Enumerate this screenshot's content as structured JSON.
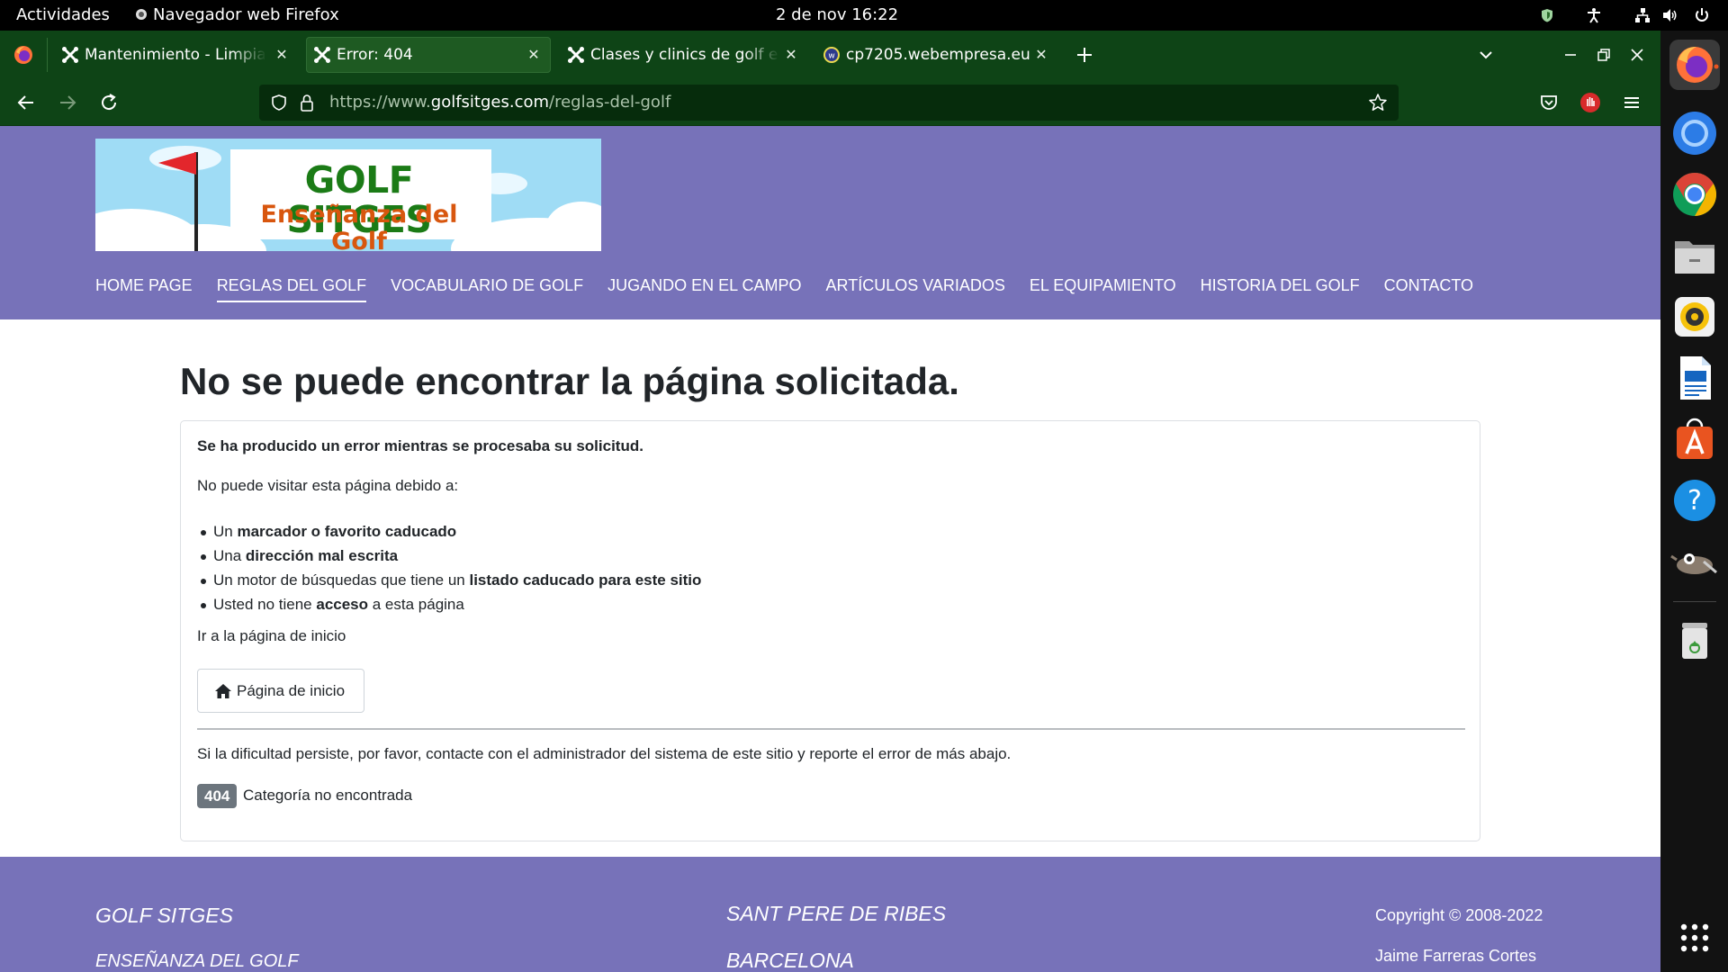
{
  "topbar": {
    "activities": "Actividades",
    "app_name": "Navegador web Firefox",
    "clock": "2 de nov  16:22"
  },
  "tabs": [
    {
      "label": "Mantenimiento - Limpiar",
      "favicon": "joomla-icon",
      "active": false
    },
    {
      "label": "Error: 404",
      "favicon": "joomla-icon",
      "active": true
    },
    {
      "label": "Clases y clinics de golf en",
      "favicon": "joomla-icon",
      "active": false
    },
    {
      "label": "cp7205.webempresa.eu",
      "favicon": "webempresa-icon",
      "active": false
    }
  ],
  "urlbar": {
    "scheme": "https://www.",
    "domain": "golfsitges.com",
    "path": "/reglas-del-golf"
  },
  "logo": {
    "line1": "GOLF SITGES",
    "line2": "Enseñanza del Golf"
  },
  "menu": [
    {
      "label": "HOME PAGE",
      "current": false
    },
    {
      "label": "REGLAS DEL GOLF",
      "current": true
    },
    {
      "label": "VOCABULARIO DE GOLF",
      "current": false
    },
    {
      "label": "JUGANDO EN EL CAMPO",
      "current": false
    },
    {
      "label": "ARTÍCULOS VARIADOS",
      "current": false
    },
    {
      "label": "EL EQUIPAMIENTO",
      "current": false
    },
    {
      "label": "HISTORIA DEL GOLF",
      "current": false
    },
    {
      "label": "CONTACTO",
      "current": false
    }
  ],
  "error": {
    "title": "No se puede encontrar la página solicitada.",
    "intro": "Se ha producido un error mientras se procesaba su solicitud.",
    "reason_lead": "No puede visitar esta página debido a:",
    "reasons": [
      {
        "pre": "Un ",
        "bold": "marcador o favorito caducado",
        "post": ""
      },
      {
        "pre": "Una ",
        "bold": "dirección mal escrita",
        "post": ""
      },
      {
        "pre": "Un motor de búsquedas que tiene un ",
        "bold": "listado caducado para este sitio",
        "post": ""
      },
      {
        "pre": "Usted no tiene ",
        "bold": "acceso",
        "post": " a esta página"
      }
    ],
    "go_home_text": "Ir a la página de inicio",
    "home_button": "Página de inicio",
    "persist_text": "Si la dificultad persiste, por favor, contacte con el administrador del sistema de este sitio y reporte el error de más abajo.",
    "code": "404",
    "message": "Categoría no encontrada"
  },
  "footer": {
    "col1_line1": "GOLF SITGES",
    "col1_line2": "ENSEÑANZA DEL GOLF",
    "col2_line1": "SANT PERE DE RIBES",
    "col2_line2": "BARCELONA",
    "col3_line1": "Copyright © 2008-2022",
    "col3_line2": "Jaime Farreras Cortes"
  },
  "dock_apps": [
    "firefox-icon",
    "chromium-icon",
    "chrome-icon",
    "files-icon",
    "rhythmbox-icon",
    "writer-icon",
    "app-center-icon",
    "help-icon",
    "gimp-icon",
    "trash-icon",
    "show-apps-icon"
  ],
  "colors": {
    "site_purple": "#7772b9",
    "firefox_green": "#0e4416",
    "badge_gray": "#6c757d"
  }
}
